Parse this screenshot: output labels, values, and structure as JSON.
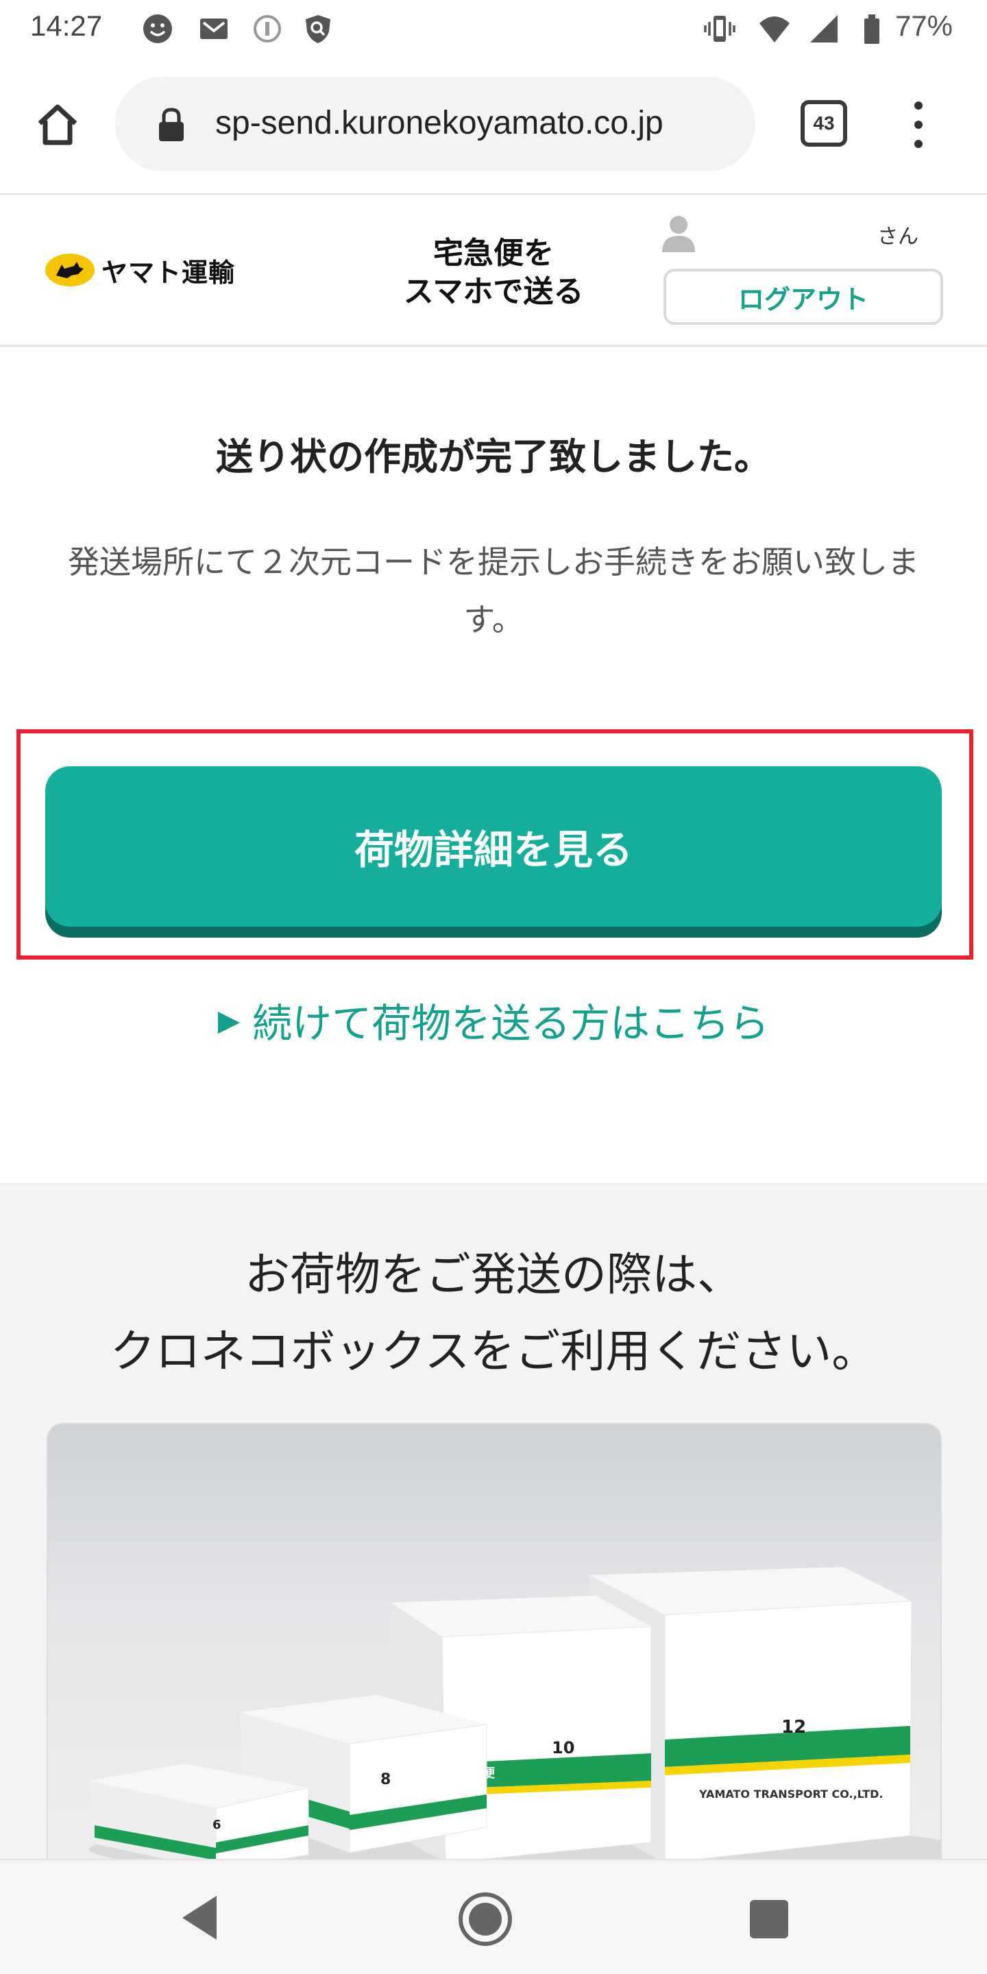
{
  "status_bar": {
    "time": "14:27",
    "battery": "77%",
    "icons": [
      "smiley-icon",
      "mail-icon",
      "info-icon",
      "shield-icon",
      "vibrate-icon",
      "wifi-icon",
      "signal-icon",
      "battery-icon"
    ]
  },
  "browser": {
    "url": "sp-send.kuronekoyamato.co.jp",
    "tab_count": "43"
  },
  "header": {
    "logo_text": "ヤマト運輸",
    "service_title_line1": "宅急便を",
    "service_title_line2": "スマホで送る",
    "user_suffix": "さん",
    "logout_label": "ログアウト"
  },
  "main": {
    "title": "送り状の作成が完了致しました。",
    "description": "発送場所にて２次元コードを提示しお手続きをお願い致します。",
    "detail_button": "荷物詳細を見る",
    "continue_link": "続けて荷物を送る方はこちら"
  },
  "promo": {
    "line1": "お荷物をご発送の際は、",
    "line2": "クロネコボックスをご利用ください。",
    "box_labels": [
      "6",
      "8",
      "10",
      "12"
    ],
    "box_band_text": "宅急便",
    "box_company_text": "YAMATO TRANSPORT CO.,LTD."
  },
  "colors": {
    "accent": "#15ae9b",
    "accent_dark": "#0b6d62",
    "highlight": "#e8232d",
    "logo_yellow": "#f5c400"
  }
}
